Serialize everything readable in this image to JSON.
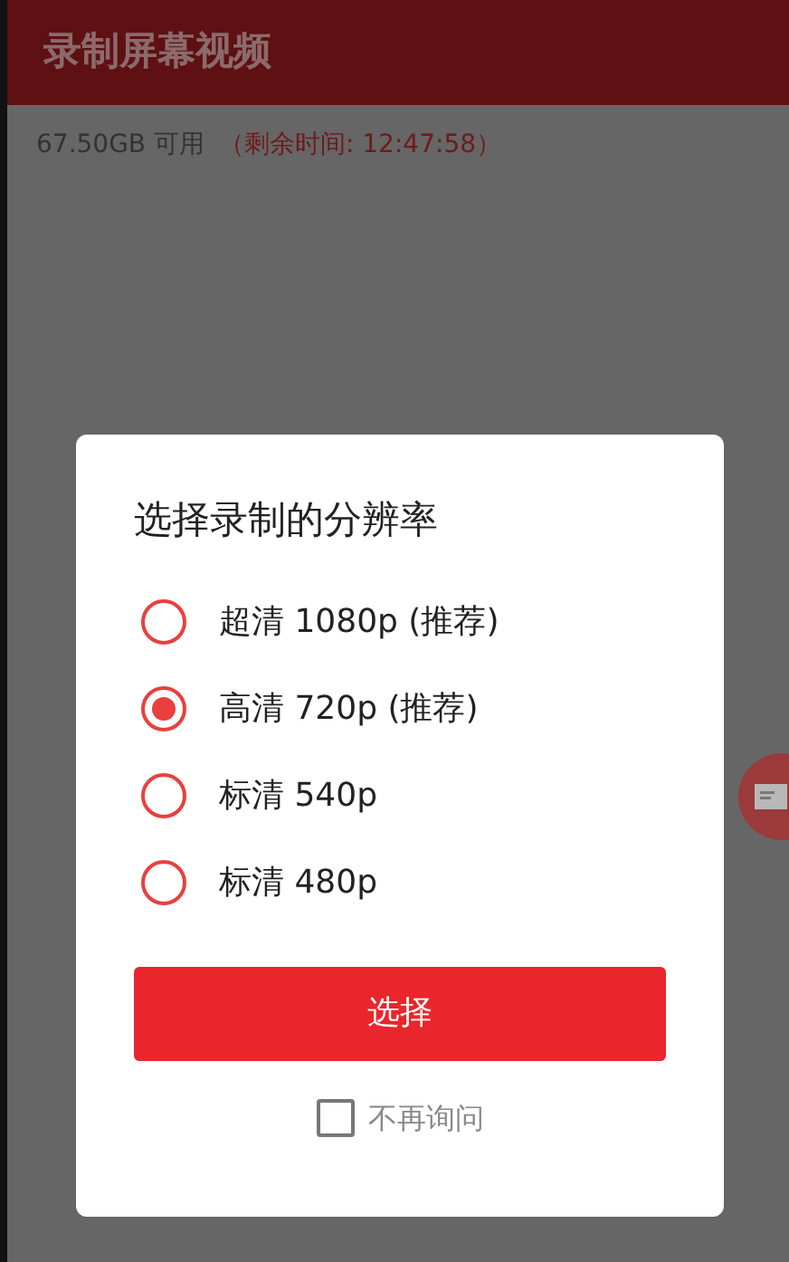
{
  "app_bar": {
    "title": "录制屏幕视频"
  },
  "storage": {
    "free": "67.50GB 可用",
    "remaining": "（剩余时间: 12:47:58）"
  },
  "dialog": {
    "title": "选择录制的分辨率",
    "options": [
      {
        "label": "超清 1080p (推荐)",
        "selected": false
      },
      {
        "label": "高清 720p (推荐)",
        "selected": true
      },
      {
        "label": "标清 540p",
        "selected": false
      },
      {
        "label": "标清 480p",
        "selected": false
      }
    ],
    "confirm_button": "选择",
    "dont_ask": {
      "label": "不再询问",
      "checked": false
    }
  }
}
